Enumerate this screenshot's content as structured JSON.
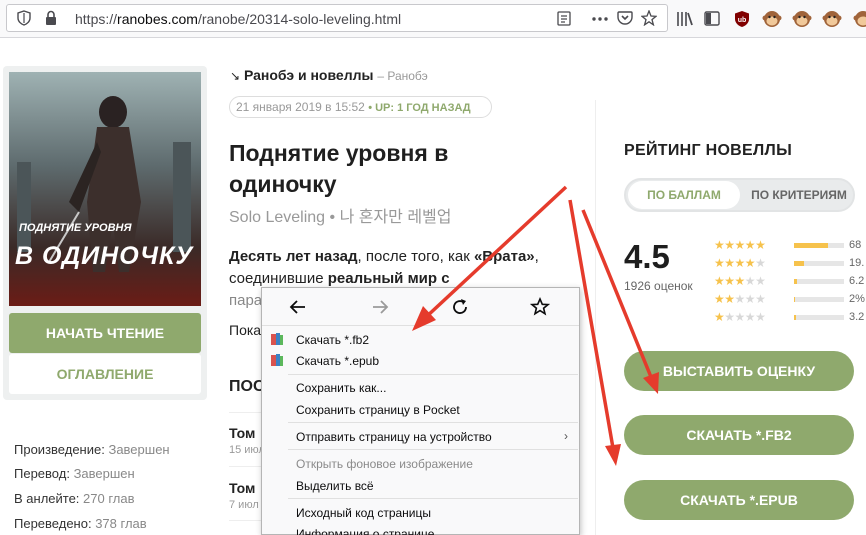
{
  "browser": {
    "url_prefix": "https://",
    "url_host": "ranobes.com",
    "url_path": "/ranobe/20314-solo-leveling.html"
  },
  "sidebar": {
    "cover_title_line1": "ПОДНЯТИЕ УРОВНЯ",
    "cover_title_line2": "В ОДИНОЧКУ",
    "read_button": "НАЧАТЬ ЧТЕНИЕ",
    "toc_button": "ОГЛАВЛЕНИЕ",
    "info": [
      {
        "label": "Произведение:",
        "value": "Завершен"
      },
      {
        "label": "Перевод:",
        "value": "Завершен"
      },
      {
        "label": "В анлейте:",
        "value": "270 глав"
      },
      {
        "label": "Переведено:",
        "value": "378 глав"
      }
    ]
  },
  "main": {
    "category": "Ранобэ и новеллы",
    "category_sub": "– Ранобэ",
    "date": "21 января 2019 в 15:52",
    "up_badge": "• UP: 1 ГОД НАЗАД",
    "title": "Поднятие уровня в одиночку",
    "alt_title": "Solo Leveling • 나 혼자만 레벨업",
    "desc_line1_bold": "Десять лет назад",
    "desc_line1_mid": ", после того, как ",
    "desc_line1_bold2": "«Врата»",
    "desc_line1_end": ",",
    "desc_line2_start": "соединившие ",
    "desc_line2_bold": "реальный мир с",
    "desc_line3_partial": "пара",
    "show_more_partial": "Пока",
    "section_head_partial": "ПОС",
    "chapters": [
      {
        "title": "Том",
        "date": "15 июл"
      },
      {
        "title": "Том",
        "date": "7 июл"
      }
    ]
  },
  "rating": {
    "heading": "РЕЙТИНГ НОВЕЛЛЫ",
    "tab_score": "ПО БАЛЛАМ",
    "tab_criteria": "ПО КРИТЕРИЯМ",
    "score": "4.5",
    "votes": "1926 оценок",
    "breakdown": [
      {
        "stars": 5,
        "pct_text": "68",
        "fill": 0.68
      },
      {
        "stars": 4,
        "pct_text": "19.",
        "fill": 0.19
      },
      {
        "stars": 3,
        "pct_text": "6.2",
        "fill": 0.062
      },
      {
        "stars": 2,
        "pct_text": "2%",
        "fill": 0.02
      },
      {
        "stars": 1,
        "pct_text": "3.2",
        "fill": 0.032
      }
    ],
    "rate_button": "ВЫСТАВИТЬ ОЦЕНКУ",
    "fb2_button": "СКАЧАТЬ *.FB2",
    "epub_button": "СКАЧАТЬ *.EPUB"
  },
  "context_menu": {
    "items": [
      {
        "label": "Скачать *.fb2",
        "extension": true
      },
      {
        "label": "Скачать *.epub",
        "extension": true
      },
      {
        "label": "Сохранить как..."
      },
      {
        "label": "Сохранить страницу в Pocket"
      },
      {
        "label": "Отправить страницу на устройство",
        "submenu": true
      },
      {
        "label": "Открыть фоновое изображение",
        "disabled": true
      },
      {
        "label": "Выделить всё"
      },
      {
        "label": "Исходный код страницы"
      },
      {
        "label": "Информация о странице"
      }
    ]
  },
  "colors": {
    "accent_green": "#8fa96d",
    "star_yellow": "#f6c24c",
    "annotation_red": "#e53b2c"
  }
}
